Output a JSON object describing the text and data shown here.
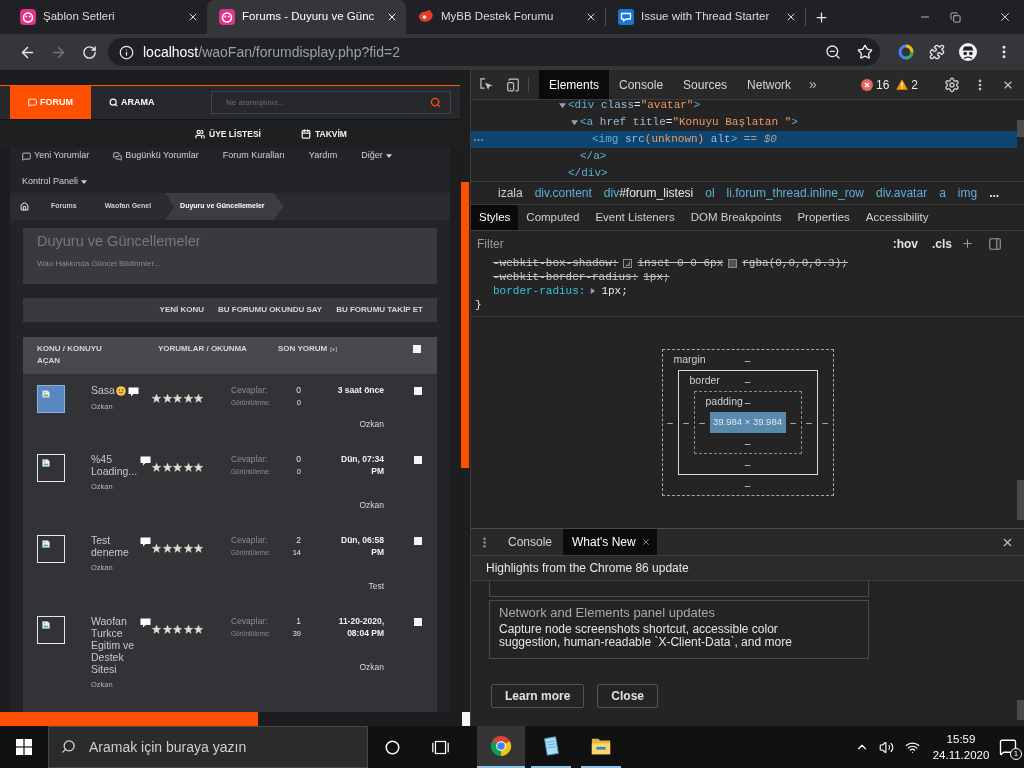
{
  "browser": {
    "tabs": [
      {
        "kind": "mybb",
        "title": "Şablon Setleri",
        "selected": false
      },
      {
        "kind": "mybb",
        "title": "Forums - Duyuru ve Günc",
        "selected": true
      },
      {
        "kind": "splash",
        "title": "MyBB Destek Forumu",
        "selected": false
      },
      {
        "kind": "chat",
        "title": "Issue with Thread Starter",
        "selected": false
      }
    ],
    "nav": {
      "forward_disabled": true
    },
    "address": {
      "host": "localhost",
      "path": "/waoFan/forumdisplay.php?fid=2"
    }
  },
  "forum_page": {
    "header_tabs": [
      {
        "kind": "comment",
        "label": "FORUM",
        "selected": true
      },
      {
        "kind": "search",
        "label": "ARAMA",
        "selected": false
      }
    ],
    "search": {
      "placeholder": "Ne aramıştınız..."
    },
    "quick_links": [
      {
        "kind": "users",
        "label": "ÜYE LİSTESİ"
      },
      {
        "kind": "calendar",
        "label": "TAKVİM"
      }
    ],
    "menu": [
      {
        "kind": "comment",
        "label": "Yeni Yorumlar"
      },
      {
        "kind": "comments",
        "label": "Bugünkü Yorumlar"
      },
      {
        "kind": "plain",
        "label": "Forum Kuralları"
      },
      {
        "kind": "plain",
        "label": "Yardım"
      },
      {
        "kind": "dropdown",
        "label": "Diğer"
      },
      {
        "kind": "dropdown",
        "label": "Kontrol Paneli"
      }
    ],
    "breadcrumb": [
      {
        "label": "Forums",
        "selected": false
      },
      {
        "label": "Waofan Genel",
        "selected": false
      },
      {
        "label": "Duyuru ve Güncellemeler",
        "selected": true
      }
    ],
    "forum": {
      "title": "Duyuru ve Güncellemeler",
      "description": "Wao Hakkında Güncel Bildirimler..."
    },
    "actions": [
      "YENİ KONU",
      "BU FORUMU OKUNDU SAY",
      "BU FORUMU TAKİP ET"
    ],
    "table": {
      "columns": [
        "KONU / KONUYU AÇAN",
        "YORUMLAR / OKUNMA",
        "SON YORUM"
      ],
      "expand": "[+]",
      "all_checked": false,
      "rows": [
        {
          "avatar": {
            "kind": "photo"
          },
          "title": "Sasa",
          "emoji": true,
          "author": "Ozkan",
          "stars": 5,
          "replies_label": "Cevaplar:",
          "replies": "0",
          "views_label": "Görüntüleme:",
          "views": "0",
          "last_post": "3 saat önce",
          "last_poster": "Ozkan",
          "checked": false
        },
        {
          "avatar": {
            "kind": "broken"
          },
          "title": "%45 Loading...",
          "emoji": false,
          "author": "Ozkan",
          "stars": 5,
          "replies_label": "Cevaplar:",
          "replies": "0",
          "views_label": "Görüntüleme:",
          "views": "0",
          "last_post": "Dün, 07:34 PM",
          "last_poster": "Ozkan",
          "checked": false
        },
        {
          "avatar": {
            "kind": "broken"
          },
          "title": "Test deneme",
          "emoji": false,
          "author": "Ozkan",
          "stars": 5,
          "replies_label": "Cevaplar:",
          "replies": "2",
          "views_label": "Görüntüleme:",
          "views": "14",
          "last_post": "Dün, 06:58 PM",
          "last_poster": "Test",
          "checked": false
        },
        {
          "avatar": {
            "kind": "broken"
          },
          "title": "Waofan Turkce Egitim ve Destek Sitesi",
          "emoji": false,
          "author": "Ozkan",
          "stars": 5,
          "replies_label": "Cevaplar:",
          "replies": "1",
          "views_label": "Görüntüleme:",
          "views": "39",
          "last_post": "11-20-2020, 08:04 PM",
          "last_poster": "Ozkan",
          "checked": false
        }
      ]
    }
  },
  "devtools": {
    "tabs": [
      {
        "label": "Elements",
        "selected": true
      },
      {
        "label": "Console",
        "selected": false
      },
      {
        "label": "Sources",
        "selected": false
      },
      {
        "label": "Network",
        "selected": false
      }
    ],
    "more": "»",
    "errors": "16",
    "warnings": "2",
    "dom": [
      {
        "kind": "container",
        "expanded": true,
        "selected": false,
        "tokens": [
          {
            "kind": "tag",
            "text": "<div"
          },
          {
            "kind": "attr",
            "text": "class"
          },
          {
            "kind": "punct",
            "text": "="
          },
          {
            "kind": "value",
            "text": "\"avatar\""
          },
          {
            "kind": "tag",
            "text": ">"
          }
        ],
        "children": [
          {
            "kind": "container",
            "expanded": true,
            "selected": false,
            "tokens": [
              {
                "kind": "tag",
                "text": "<a"
              },
              {
                "kind": "attr",
                "text": "href"
              },
              {
                "kind": "attr",
                "text": "title"
              },
              {
                "kind": "punct",
                "text": "="
              },
              {
                "kind": "value",
                "text": "\"Konuyu Başlatan \""
              },
              {
                "kind": "tag",
                "text": ">"
              }
            ],
            "children": [
              {
                "kind": "leaf",
                "selected": true,
                "tokens": [
                  {
                    "kind": "tag",
                    "text": "<img"
                  },
                  {
                    "kind": "attr",
                    "text": "src"
                  },
                  {
                    "kind": "value",
                    "text": "(unknown)"
                  },
                  {
                    "kind": "attr",
                    "text": "alt"
                  },
                  {
                    "kind": "tag",
                    "text": ">"
                  }
                ],
                "suffix": "== $0"
              }
            ],
            "closing": [
              {
                "kind": "tag",
                "text": "</a>"
              }
            ]
          }
        ],
        "closing": [
          {
            "kind": "tag",
            "text": "</div>"
          }
        ]
      }
    ],
    "crumbs": [
      {
        "parts": [
          {
            "kind": "text",
            "text": "izala"
          }
        ]
      },
      {
        "parts": [
          {
            "kind": "tag",
            "text": "div"
          },
          {
            "kind": "class",
            "text": ".content"
          }
        ]
      },
      {
        "parts": [
          {
            "kind": "tag",
            "text": "div"
          },
          {
            "kind": "id",
            "text": "#forum_listesi"
          }
        ]
      },
      {
        "parts": [
          {
            "kind": "tag",
            "text": "ol"
          }
        ]
      },
      {
        "parts": [
          {
            "kind": "tag",
            "text": "li"
          },
          {
            "kind": "class",
            "text": ".forum_thread.inline_row"
          }
        ]
      },
      {
        "parts": [
          {
            "kind": "tag",
            "text": "div"
          },
          {
            "kind": "class",
            "text": ".avatar"
          }
        ]
      },
      {
        "parts": [
          {
            "kind": "tag",
            "text": "a"
          }
        ]
      },
      {
        "parts": [
          {
            "kind": "tag",
            "text": "img"
          }
        ]
      }
    ],
    "crumbs_more": "...",
    "style_tabs": [
      {
        "label": "Styles",
        "selected": true
      },
      {
        "label": "Computed",
        "selected": false
      },
      {
        "label": "Event Listeners",
        "selected": false
      },
      {
        "label": "DOM Breakpoints",
        "selected": false
      },
      {
        "label": "Properties",
        "selected": false
      },
      {
        "label": "Accessibility",
        "selected": false
      }
    ],
    "filter": {
      "placeholder": "Filter"
    },
    "toggles": [
      ":hov",
      ".cls"
    ],
    "rules": [
      {
        "name": "-webkit-box-shadow:",
        "overridden": true,
        "parts": [
          {
            "kind": "shadow"
          },
          {
            "kind": "text",
            "text": "inset 0 0 6px"
          },
          {
            "kind": "swatch"
          },
          {
            "kind": "text",
            "text": "rgba(0,0,0,0.3);"
          }
        ]
      },
      {
        "name": "-webkit-border-radius:",
        "overridden": true,
        "parts": [
          {
            "kind": "text",
            "text": "1px;"
          }
        ]
      },
      {
        "name": "border-radius:",
        "overridden": false,
        "parts": [
          {
            "kind": "expander"
          },
          {
            "kind": "text",
            "text": "1px;"
          }
        ]
      }
    ],
    "rule_end": "}",
    "box_model": {
      "margin": {
        "label": "margin",
        "top": "–",
        "right": "–",
        "bottom": "–",
        "left": "–"
      },
      "border": {
        "label": "border",
        "top": "–",
        "right": "–",
        "bottom": "–",
        "left": "–"
      },
      "padding": {
        "label": "padding",
        "top": "–",
        "right": "–",
        "bottom": "–",
        "left": "–"
      },
      "content": "39.984 × 39.984"
    },
    "drawer": {
      "tabs": [
        {
          "label": "Console",
          "selected": false,
          "closable": false
        },
        {
          "label": "What's New",
          "selected": true,
          "closable": true
        }
      ],
      "title": "Highlights from the Chrome 86 update",
      "cards": [
        {
          "title": "Network and Elements panel updates",
          "body": "Capture node screenshots shortcut, accessible color suggestion, human-readable `X-Client-Data`, and more"
        }
      ],
      "buttons": [
        "Learn more",
        "Close"
      ]
    }
  },
  "taskbar": {
    "search": {
      "placeholder": "Aramak için buraya yazın"
    },
    "apps": [
      {
        "kind": "chrome",
        "selected": true,
        "open": true
      },
      {
        "kind": "notes",
        "selected": false,
        "open": true
      },
      {
        "kind": "explorer",
        "selected": false,
        "open": true
      }
    ],
    "time": "15:59",
    "date": "24.11.2020",
    "notifications": "1"
  }
}
